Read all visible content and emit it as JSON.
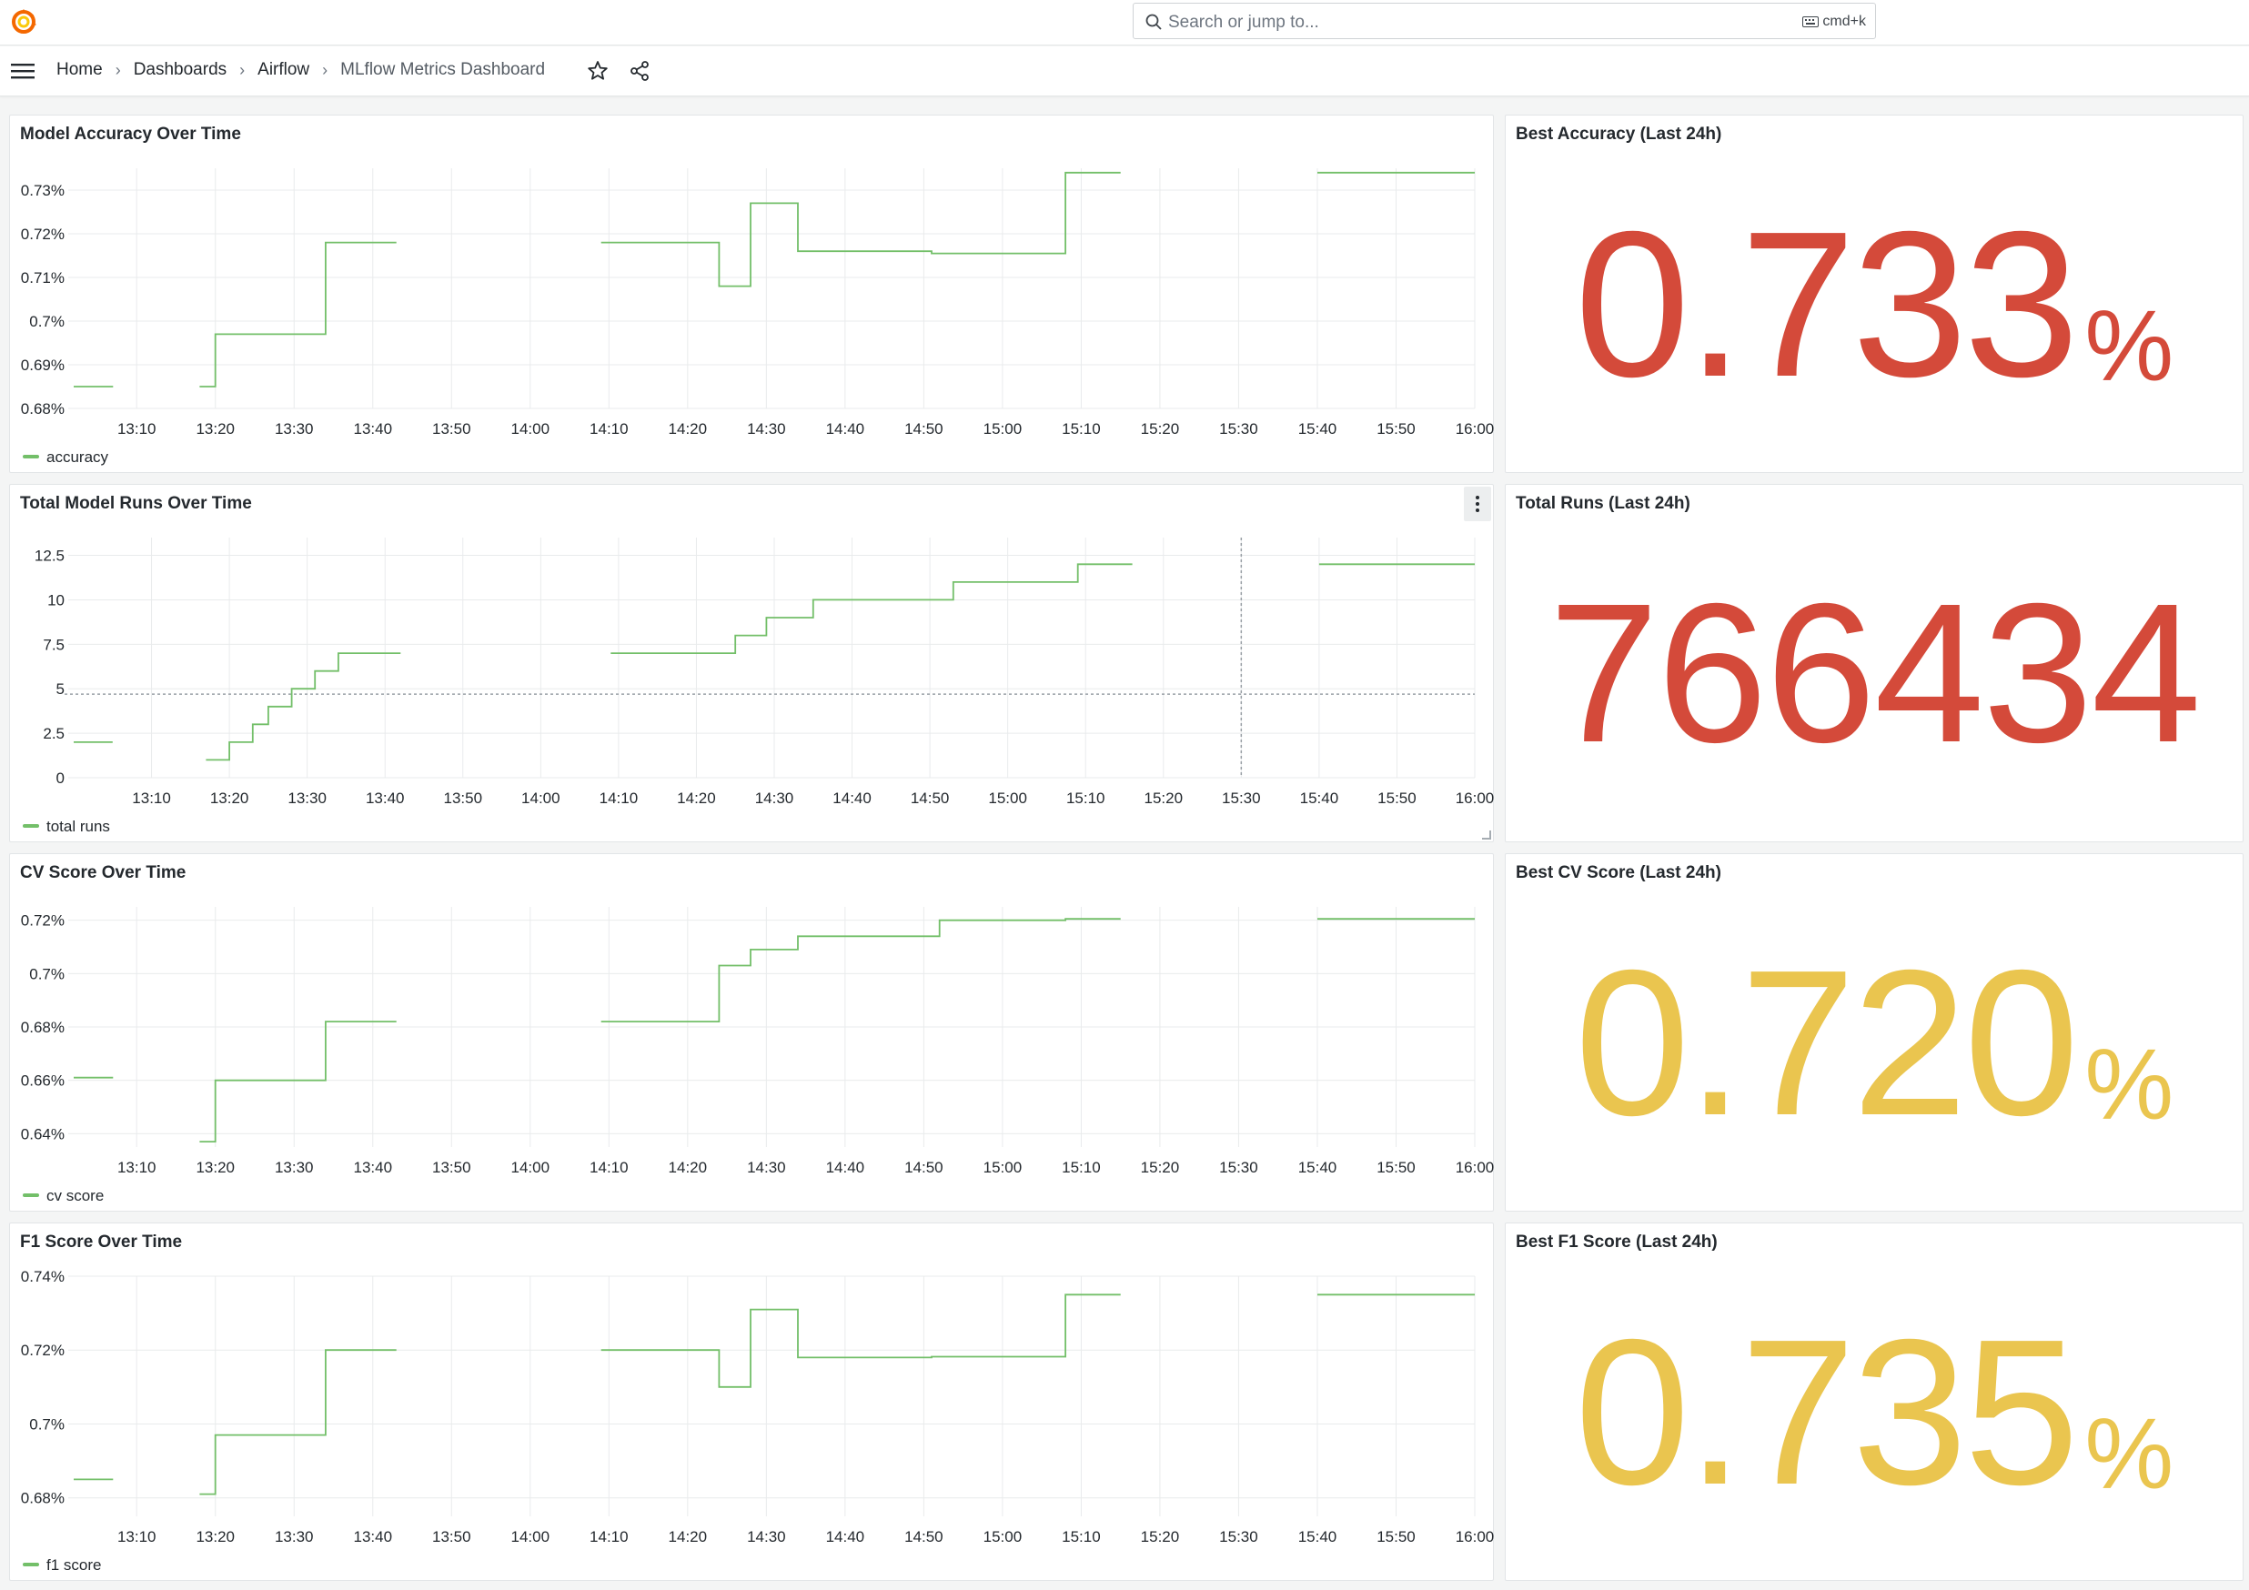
{
  "topbar": {
    "logo_icon": "grafana-logo-icon",
    "search_placeholder": "Search or jump to...",
    "search_shortcut": "cmd+k"
  },
  "breadcrumb": {
    "items": [
      "Home",
      "Dashboards",
      "Airflow",
      "MLflow Metrics Dashboard"
    ],
    "separator": "›"
  },
  "colors": {
    "series": "#73bf69",
    "stat_red": "#d44a3a",
    "stat_yellow": "#eac54f",
    "grid": "#e9ebec"
  },
  "panels": {
    "accuracy": {
      "title": "Model Accuracy Over Time",
      "legend": "accuracy"
    },
    "runs": {
      "title": "Total Model Runs Over Time",
      "legend": "total runs"
    },
    "cv": {
      "title": "CV Score Over Time",
      "legend": "cv score"
    },
    "f1": {
      "title": "F1 Score Over Time",
      "legend": "f1 score"
    },
    "stat_accuracy": {
      "title": "Best Accuracy (Last 24h)",
      "value": "0.733",
      "unit": "%",
      "color": "#d44a3a"
    },
    "stat_runs": {
      "title": "Total Runs (Last 24h)",
      "value": "766434",
      "unit": "",
      "color": "#d44a3a"
    },
    "stat_cv": {
      "title": "Best CV Score (Last 24h)",
      "value": "0.720",
      "unit": "%",
      "color": "#eac54f"
    },
    "stat_f1": {
      "title": "Best F1 Score (Last 24h)",
      "value": "0.735",
      "unit": "%",
      "color": "#eac54f"
    }
  },
  "chart_data": [
    {
      "type": "line",
      "title": "Model Accuracy Over Time",
      "x_ticks": [
        "13:10",
        "13:20",
        "13:30",
        "13:40",
        "13:50",
        "14:00",
        "14:10",
        "14:20",
        "14:30",
        "14:40",
        "14:50",
        "15:00",
        "15:10",
        "15:20",
        "15:30",
        "15:40",
        "15:50",
        "16:00"
      ],
      "y_ticks": [
        "0.68%",
        "0.69%",
        "0.7%",
        "0.71%",
        "0.72%",
        "0.73%"
      ],
      "ylim": [
        0.68,
        0.735
      ],
      "xlim": [
        "13:02",
        "16:00"
      ],
      "step": true,
      "series": [
        {
          "name": "accuracy",
          "segments": [
            [
              [
                "13:02",
                0.685
              ],
              [
                "13:07",
                0.685
              ]
            ],
            [
              [
                "13:18",
                0.685
              ],
              [
                "13:20",
                0.685
              ],
              [
                "13:20",
                0.697
              ],
              [
                "13:34",
                0.697
              ],
              [
                "13:34",
                0.718
              ],
              [
                "13:43",
                0.718
              ]
            ],
            [
              [
                "14:09",
                0.718
              ],
              [
                "14:24",
                0.718
              ],
              [
                "14:24",
                0.708
              ],
              [
                "14:28",
                0.708
              ],
              [
                "14:28",
                0.727
              ],
              [
                "14:34",
                0.727
              ],
              [
                "14:34",
                0.716
              ],
              [
                "14:51",
                0.716
              ],
              [
                "14:51",
                0.7155
              ],
              [
                "15:08",
                0.7155
              ],
              [
                "15:08",
                0.734
              ],
              [
                "15:15",
                0.734
              ]
            ],
            [
              [
                "15:40",
                0.734
              ],
              [
                "16:00",
                0.734
              ]
            ]
          ]
        }
      ]
    },
    {
      "type": "line",
      "title": "Total Model Runs Over Time",
      "x_ticks": [
        "13:10",
        "13:20",
        "13:30",
        "13:40",
        "13:50",
        "14:00",
        "14:10",
        "14:20",
        "14:30",
        "14:40",
        "14:50",
        "15:00",
        "15:10",
        "15:20",
        "15:30",
        "15:40",
        "15:50",
        "16:00"
      ],
      "y_ticks": [
        "0",
        "2.5",
        "5",
        "7.5",
        "10",
        "12.5"
      ],
      "ylim": [
        0,
        13.5
      ],
      "xlim": [
        "13:00",
        "16:00"
      ],
      "step": true,
      "threshold": 4.7,
      "crosshair_x": "15:30",
      "series": [
        {
          "name": "total runs",
          "segments": [
            [
              [
                "13:00",
                2
              ],
              [
                "13:05",
                2
              ]
            ],
            [
              [
                "13:17",
                1
              ],
              [
                "13:20",
                1
              ],
              [
                "13:20",
                2
              ],
              [
                "13:23",
                2
              ],
              [
                "13:23",
                3
              ],
              [
                "13:25",
                3
              ],
              [
                "13:25",
                4
              ],
              [
                "13:28",
                4
              ],
              [
                "13:28",
                5
              ],
              [
                "13:31",
                5
              ],
              [
                "13:31",
                6
              ],
              [
                "13:34",
                6
              ],
              [
                "13:34",
                7
              ],
              [
                "13:42",
                7
              ]
            ],
            [
              [
                "14:09",
                7
              ],
              [
                "14:25",
                7
              ],
              [
                "14:25",
                8
              ],
              [
                "14:29",
                8
              ],
              [
                "14:29",
                9
              ],
              [
                "14:35",
                9
              ],
              [
                "14:35",
                10
              ],
              [
                "14:53",
                10
              ],
              [
                "14:53",
                11
              ],
              [
                "15:09",
                11
              ],
              [
                "15:09",
                12
              ],
              [
                "15:16",
                12
              ]
            ],
            [
              [
                "15:40",
                12
              ],
              [
                "16:00",
                12
              ]
            ]
          ]
        }
      ]
    },
    {
      "type": "line",
      "title": "CV Score Over Time",
      "x_ticks": [
        "13:10",
        "13:20",
        "13:30",
        "13:40",
        "13:50",
        "14:00",
        "14:10",
        "14:20",
        "14:30",
        "14:40",
        "14:50",
        "15:00",
        "15:10",
        "15:20",
        "15:30",
        "15:40",
        "15:50",
        "16:00"
      ],
      "y_ticks": [
        "0.64%",
        "0.66%",
        "0.68%",
        "0.7%",
        "0.72%"
      ],
      "ylim": [
        0.635,
        0.725
      ],
      "xlim": [
        "13:02",
        "16:00"
      ],
      "step": true,
      "series": [
        {
          "name": "cv score",
          "segments": [
            [
              [
                "13:02",
                0.661
              ],
              [
                "13:07",
                0.661
              ]
            ],
            [
              [
                "13:18",
                0.637
              ],
              [
                "13:20",
                0.637
              ],
              [
                "13:20",
                0.66
              ],
              [
                "13:34",
                0.66
              ],
              [
                "13:34",
                0.682
              ],
              [
                "13:43",
                0.682
              ]
            ],
            [
              [
                "14:09",
                0.682
              ],
              [
                "14:24",
                0.682
              ],
              [
                "14:24",
                0.703
              ],
              [
                "14:28",
                0.703
              ],
              [
                "14:28",
                0.709
              ],
              [
                "14:34",
                0.709
              ],
              [
                "14:34",
                0.714
              ],
              [
                "14:52",
                0.714
              ],
              [
                "14:52",
                0.72
              ],
              [
                "15:08",
                0.72
              ],
              [
                "15:08",
                0.7205
              ],
              [
                "15:15",
                0.7205
              ]
            ],
            [
              [
                "15:40",
                0.7205
              ],
              [
                "16:00",
                0.7205
              ]
            ]
          ]
        }
      ]
    },
    {
      "type": "line",
      "title": "F1 Score Over Time",
      "x_ticks": [
        "13:10",
        "13:20",
        "13:30",
        "13:40",
        "13:50",
        "14:00",
        "14:10",
        "14:20",
        "14:30",
        "14:40",
        "14:50",
        "15:00",
        "15:10",
        "15:20",
        "15:30",
        "15:40",
        "15:50",
        "16:00"
      ],
      "y_ticks": [
        "0.68%",
        "0.7%",
        "0.72%",
        "0.74%"
      ],
      "ylim": [
        0.675,
        0.74
      ],
      "xlim": [
        "13:02",
        "16:00"
      ],
      "step": true,
      "series": [
        {
          "name": "f1 score",
          "segments": [
            [
              [
                "13:02",
                0.685
              ],
              [
                "13:07",
                0.685
              ]
            ],
            [
              [
                "13:18",
                0.681
              ],
              [
                "13:20",
                0.681
              ],
              [
                "13:20",
                0.697
              ],
              [
                "13:34",
                0.697
              ],
              [
                "13:34",
                0.72
              ],
              [
                "13:43",
                0.72
              ]
            ],
            [
              [
                "14:09",
                0.72
              ],
              [
                "14:24",
                0.72
              ],
              [
                "14:24",
                0.71
              ],
              [
                "14:28",
                0.71
              ],
              [
                "14:28",
                0.731
              ],
              [
                "14:34",
                0.731
              ],
              [
                "14:34",
                0.718
              ],
              [
                "14:51",
                0.718
              ],
              [
                "14:51",
                0.7182
              ],
              [
                "15:08",
                0.7182
              ],
              [
                "15:08",
                0.735
              ],
              [
                "15:15",
                0.735
              ]
            ],
            [
              [
                "15:40",
                0.735
              ],
              [
                "16:00",
                0.735
              ]
            ]
          ]
        }
      ]
    }
  ]
}
